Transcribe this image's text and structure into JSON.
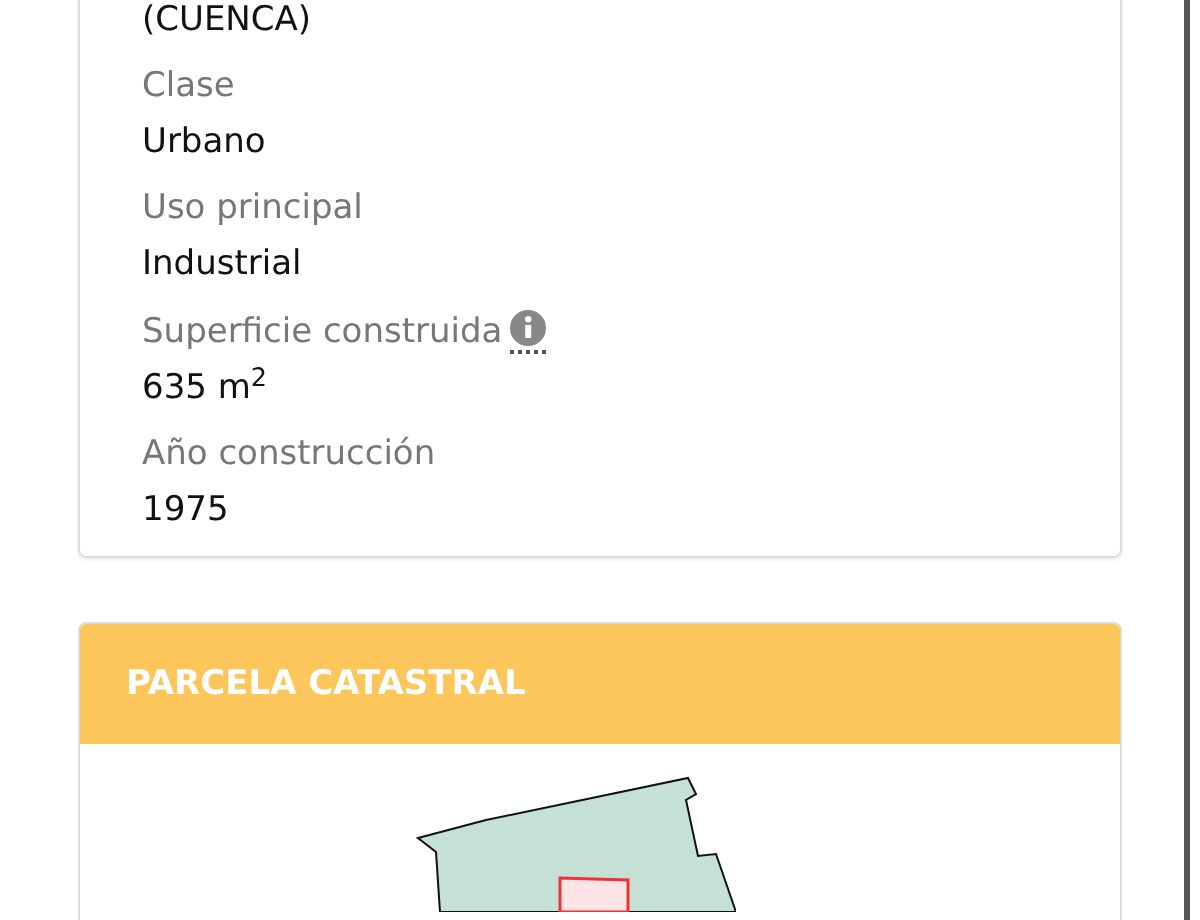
{
  "property_card": {
    "address_tail": "(CUENCA)",
    "fields": [
      {
        "label": "Clase",
        "value": "Urbano",
        "info": false
      },
      {
        "label": "Uso principal",
        "value": "Industrial",
        "info": false
      },
      {
        "label": "Superficie construida",
        "value": "635 m$^{2}$",
        "info": true
      },
      {
        "label": "Año construcción",
        "value": "1975",
        "info": false
      }
    ]
  },
  "parcel_card": {
    "title": "PARCELA CATASTRAL"
  }
}
